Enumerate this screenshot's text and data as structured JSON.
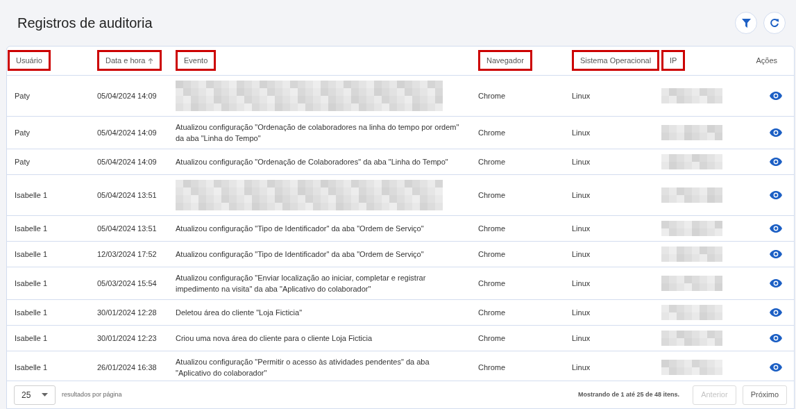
{
  "title": "Registros de auditoria",
  "toolbar": [
    {
      "kind": "filter"
    },
    {
      "kind": "refresh"
    }
  ],
  "columns": [
    {
      "label": "Usuário",
      "highlighted": true,
      "sorted": false
    },
    {
      "label": "Data e hora",
      "highlighted": true,
      "sorted": true
    },
    {
      "label": "Evento",
      "highlighted": true,
      "sorted": false
    },
    {
      "label": "Navegador",
      "highlighted": true,
      "sorted": false
    },
    {
      "label": "Sistema Operacional",
      "highlighted": true,
      "sorted": false
    },
    {
      "label": "IP",
      "highlighted": true,
      "sorted": false
    },
    {
      "label": "Ações",
      "highlighted": false,
      "sorted": false
    }
  ],
  "rows": [
    {
      "user": "Paty",
      "date": "05/04/2024 14:09",
      "event": {
        "kind": "redacted"
      },
      "browser": "Chrome",
      "os": "Linux",
      "ip": {
        "kind": "redacted"
      }
    },
    {
      "user": "Paty",
      "date": "05/04/2024 14:09",
      "event": {
        "kind": "text",
        "text": "Atualizou configuração \"Ordenação de colaboradores na linha do tempo por ordem\" da aba \"Linha do Tempo\""
      },
      "browser": "Chrome",
      "os": "Linux",
      "ip": {
        "kind": "redacted"
      }
    },
    {
      "user": "Paty",
      "date": "05/04/2024 14:09",
      "event": {
        "kind": "text",
        "text": "Atualizou configuração \"Ordenação de Colaboradores\" da aba \"Linha do Tempo\""
      },
      "browser": "Chrome",
      "os": "Linux",
      "ip": {
        "kind": "redacted"
      }
    },
    {
      "user": "Isabelle 1",
      "date": "05/04/2024 13:51",
      "event": {
        "kind": "redacted"
      },
      "browser": "Chrome",
      "os": "Linux",
      "ip": {
        "kind": "redacted"
      }
    },
    {
      "user": "Isabelle 1",
      "date": "05/04/2024 13:51",
      "event": {
        "kind": "text",
        "text": "Atualizou configuração \"Tipo de Identificador\" da aba \"Ordem de Serviço\""
      },
      "browser": "Chrome",
      "os": "Linux",
      "ip": {
        "kind": "redacted"
      }
    },
    {
      "user": "Isabelle 1",
      "date": "12/03/2024 17:52",
      "event": {
        "kind": "text",
        "text": "Atualizou configuração \"Tipo de Identificador\" da aba \"Ordem de Serviço\""
      },
      "browser": "Chrome",
      "os": "Linux",
      "ip": {
        "kind": "redacted"
      }
    },
    {
      "user": "Isabelle 1",
      "date": "05/03/2024 15:54",
      "event": {
        "kind": "text",
        "text": "Atualizou configuração \"Enviar localização ao iniciar, completar e registrar impedimento na visita\" da aba \"Aplicativo do colaborador\""
      },
      "browser": "Chrome",
      "os": "Linux",
      "ip": {
        "kind": "redacted"
      }
    },
    {
      "user": "Isabelle 1",
      "date": "30/01/2024 12:28",
      "event": {
        "kind": "text",
        "text": "Deletou área do cliente \"Loja Ficticia\""
      },
      "browser": "Chrome",
      "os": "Linux",
      "ip": {
        "kind": "redacted"
      }
    },
    {
      "user": "Isabelle 1",
      "date": "30/01/2024 12:23",
      "event": {
        "kind": "text",
        "text": "Criou uma nova área do cliente para o cliente Loja Ficticia"
      },
      "browser": "Chrome",
      "os": "Linux",
      "ip": {
        "kind": "redacted"
      }
    },
    {
      "user": "Isabelle 1",
      "date": "26/01/2024 16:38",
      "event": {
        "kind": "text",
        "text": "Atualizou configuração \"Permitir o acesso às atividades pendentes\" da aba \"Aplicativo do colaborador\""
      },
      "browser": "Chrome",
      "os": "Linux",
      "ip": {
        "kind": "redacted"
      }
    }
  ],
  "footer": {
    "page_size": "25",
    "page_size_label": "resultados por página",
    "summary": "Mostrando de 1 até 25 de 48 itens.",
    "buttons": [
      {
        "label": "Anterior",
        "disabled": true
      },
      {
        "label": "Próximo",
        "disabled": false
      }
    ]
  }
}
